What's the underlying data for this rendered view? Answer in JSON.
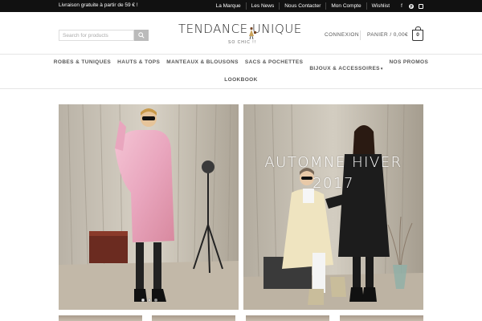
{
  "topbar": {
    "promo": "Livraison gratuite à partir de 59 € !",
    "links": [
      "La Marque",
      "Les News",
      "Nous Contacter",
      "Mon Compte",
      "Wishlist"
    ],
    "social_icons": [
      "facebook-icon",
      "pinterest-icon",
      "instagram-icon"
    ]
  },
  "header": {
    "search_placeholder": "Search for products",
    "logo_name": "TENDANCE UNIQUE",
    "logo_tagline": "SO CHIC !!",
    "account_label": "CONNEXION",
    "cart_label": "PANIER / 0,00€",
    "cart_count": "0"
  },
  "nav": {
    "row1": [
      "ROBES & TUNIQUES",
      "HAUTS & TOPS",
      "MANTEAUX & BLOUSONS",
      "SACS & POCHETTES",
      "BIJOUX & ACCESSOIRES",
      "NOS PROMOS"
    ],
    "row2": [
      "LOOKBOOK"
    ]
  },
  "hero": {
    "right_title_line1": "AUTOMNE HIVER",
    "right_title_line2": "2017",
    "slide_count": 3,
    "active_slide": 1
  },
  "colors": {
    "topbar_bg": "#111111",
    "accent": "#333333",
    "dress_pink": "#e9a6be"
  }
}
